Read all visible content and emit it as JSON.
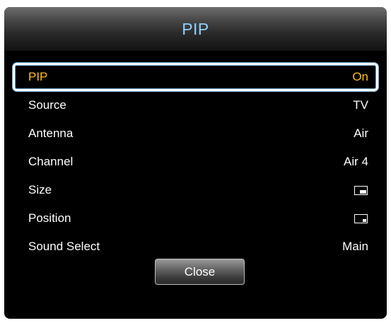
{
  "dialog": {
    "title": "PIP"
  },
  "menu": {
    "items": [
      {
        "label": "PIP",
        "value": "On"
      },
      {
        "label": "Source",
        "value": "TV"
      },
      {
        "label": "Antenna",
        "value": "Air"
      },
      {
        "label": "Channel",
        "value": "Air 4"
      },
      {
        "label": "Size",
        "icon": "pip-size-icon"
      },
      {
        "label": "Position",
        "icon": "pip-position-icon"
      },
      {
        "label": "Sound Select",
        "value": "Main"
      }
    ]
  },
  "buttons": {
    "close_label": "Close"
  },
  "colors": {
    "title": "#8ed0ff",
    "selected_text": "#ffbb1e",
    "text": "#ffffff",
    "background": "#000000"
  }
}
